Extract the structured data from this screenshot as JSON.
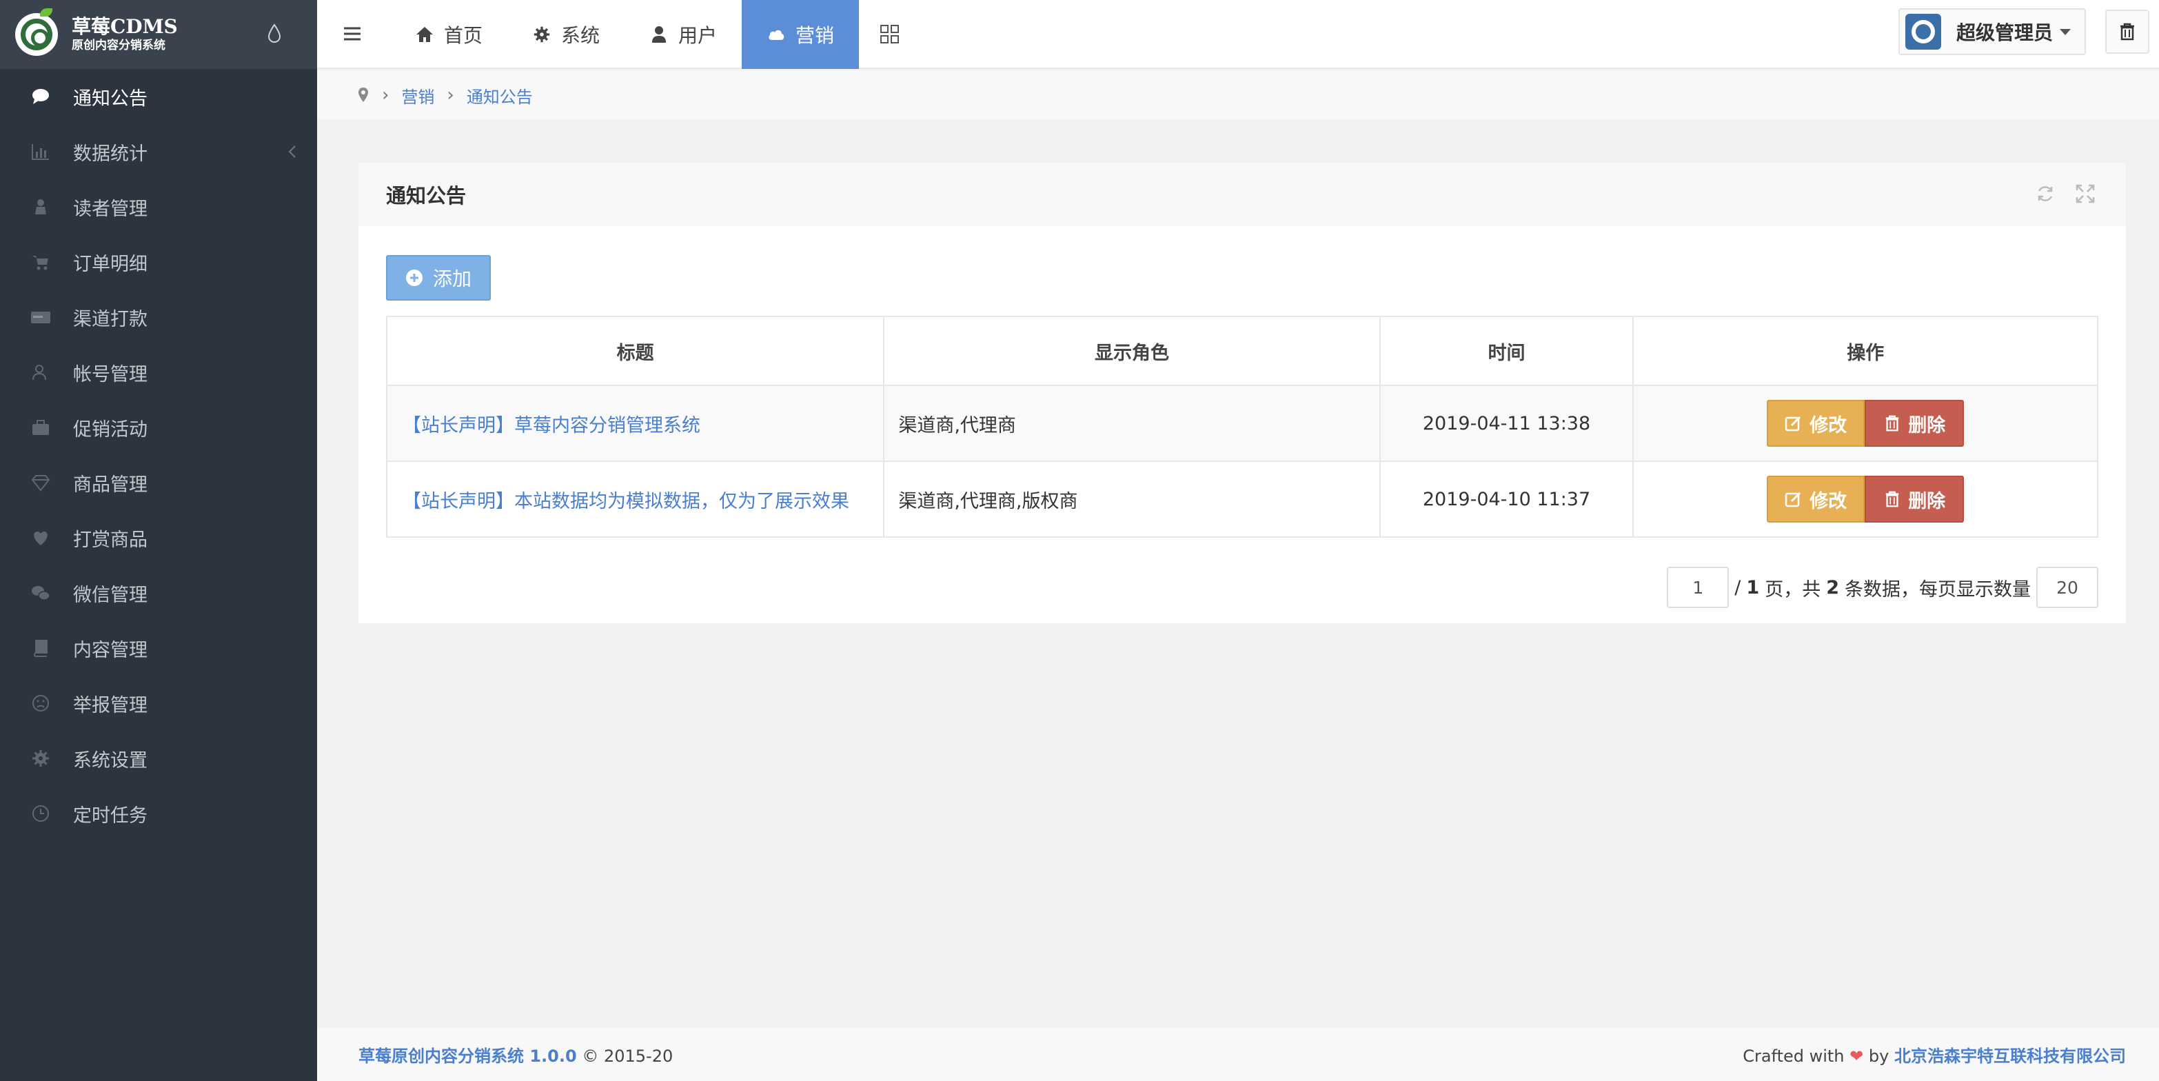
{
  "brand": {
    "title": "草莓CDMS",
    "subtitle": "原创内容分销系统"
  },
  "sidebar": {
    "items": [
      {
        "label": "通知公告",
        "icon": "comment-icon",
        "active": true
      },
      {
        "label": "数据统计",
        "icon": "bar-chart-icon",
        "has_children": true
      },
      {
        "label": "读者管理",
        "icon": "reader-icon"
      },
      {
        "label": "订单明细",
        "icon": "cart-icon"
      },
      {
        "label": "渠道打款",
        "icon": "card-icon"
      },
      {
        "label": "帐号管理",
        "icon": "user-icon"
      },
      {
        "label": "促销活动",
        "icon": "briefcase-icon"
      },
      {
        "label": "商品管理",
        "icon": "diamond-icon"
      },
      {
        "label": "打赏商品",
        "icon": "heart-icon"
      },
      {
        "label": "微信管理",
        "icon": "wechat-icon"
      },
      {
        "label": "内容管理",
        "icon": "book-icon"
      },
      {
        "label": "举报管理",
        "icon": "face-icon"
      },
      {
        "label": "系统设置",
        "icon": "gear-icon"
      },
      {
        "label": "定时任务",
        "icon": "clock-icon"
      }
    ]
  },
  "topnav": {
    "items": [
      {
        "label": "首页",
        "icon": "home-icon"
      },
      {
        "label": "系统",
        "icon": "gear-icon"
      },
      {
        "label": "用户",
        "icon": "user-icon"
      },
      {
        "label": "营销",
        "icon": "cloud-icon",
        "active": true
      }
    ]
  },
  "user": {
    "name": "超级管理员"
  },
  "breadcrumb": {
    "items": [
      "营销",
      "通知公告"
    ]
  },
  "panel": {
    "title": "通知公告",
    "add_label": "添加"
  },
  "table": {
    "headers": [
      "标题",
      "显示角色",
      "时间",
      "操作"
    ],
    "rows": [
      {
        "title": "【站长声明】草莓内容分销管理系统",
        "roles": "渠道商,代理商",
        "time": "2019-04-11 13:38"
      },
      {
        "title": "【站长声明】本站数据均为模拟数据，仅为了展示效果",
        "roles": "渠道商,代理商,版权商",
        "time": "2019-04-10 11:37"
      }
    ],
    "edit_label": "修改",
    "delete_label": "删除"
  },
  "pager": {
    "page": "1",
    "text_page_sep": "/",
    "total_pages": "1",
    "text_pages": "页，共",
    "total_records": "2",
    "text_records": "条数据，每页显示数量",
    "page_size": "20"
  },
  "footer": {
    "product": "草莓原创内容分销系统 1.0.0",
    "copyright": "© 2015-20",
    "crafted": "Crafted with",
    "heart": "❤",
    "by": "by",
    "company": "北京浩森宇特互联科技有限公司"
  },
  "colors": {
    "sidebar_bg": "#2c343f",
    "accent": "#5b8ed6",
    "edit": "#e8b054",
    "delete": "#c55d50",
    "link": "#4a7fcf"
  }
}
